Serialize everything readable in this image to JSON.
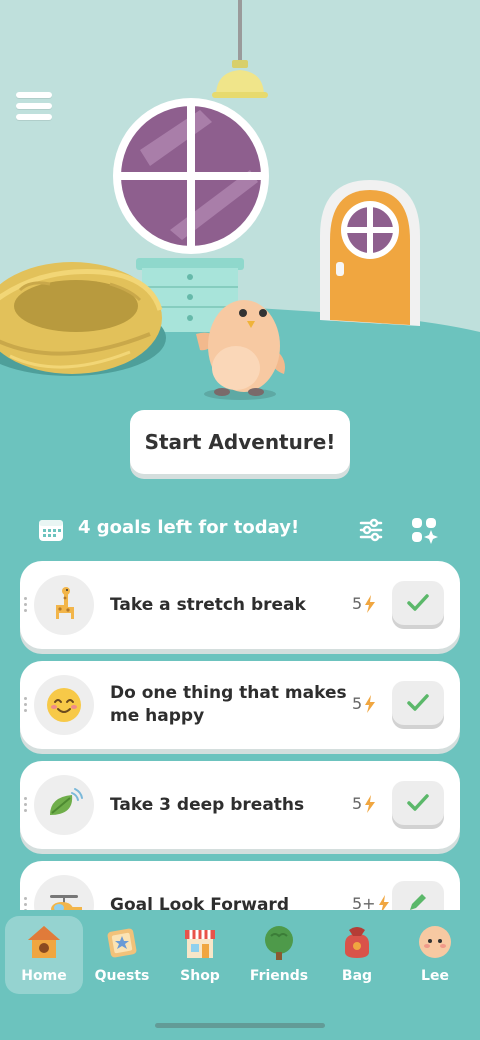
{
  "scene": {
    "menu_icon": "hamburger-menu-icon",
    "character": "orange-bird-character"
  },
  "start_button_label": "Start Adventure!",
  "goals_header": {
    "calendar_icon": "calendar-icon",
    "text": "4 goals left for today!",
    "filter_icon": "filter-sliders-icon",
    "add_icon": "add-goal-grid-icon"
  },
  "goals": [
    {
      "title": "Take a stretch break",
      "energy": "5",
      "icon": "giraffe-icon",
      "action_icon": "check-icon"
    },
    {
      "title": "Do one thing that makes me happy",
      "energy": "5",
      "icon": "smiley-face-icon",
      "action_icon": "check-icon"
    },
    {
      "title": "Take 3 deep breaths",
      "energy": "5",
      "icon": "leaf-wind-icon",
      "action_icon": "check-icon"
    },
    {
      "title": "Goal Look Forward",
      "energy": "5+",
      "icon": "helicopter-icon",
      "action_icon": "pencil-icon"
    }
  ],
  "nav": [
    {
      "label": "Home",
      "icon": "birdhouse-icon",
      "active": true
    },
    {
      "label": "Quests",
      "icon": "quest-map-icon",
      "active": false
    },
    {
      "label": "Shop",
      "icon": "shop-icon",
      "active": false
    },
    {
      "label": "Friends",
      "icon": "tree-icon",
      "active": false
    },
    {
      "label": "Bag",
      "icon": "bag-icon",
      "active": false
    },
    {
      "label": "Lee",
      "icon": "profile-avatar-icon",
      "active": false
    }
  ],
  "colors": {
    "teal": "#6cc3be",
    "wall": "#bfe0dc",
    "accent_orange": "#f0a640",
    "check_green": "#5bb86a",
    "energy_yellow": "#f0a640"
  }
}
